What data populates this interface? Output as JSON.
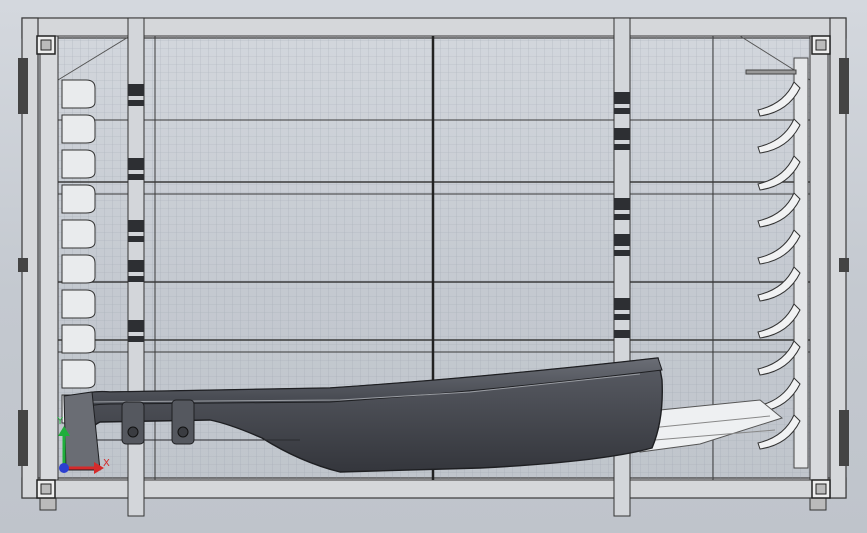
{
  "viewport": {
    "label": "graphics-area"
  },
  "colors": {
    "background": "#c9ced6",
    "frame_fill": "#d7d9dc",
    "frame_stroke": "#3a3a3a",
    "mesh_line": "#7d8590",
    "part_dark": "#4a4d55",
    "part_light": "#e8eaec",
    "axis_x": "#d42a2a",
    "axis_y": "#1fae3b",
    "axis_z": "#2b3fd1"
  },
  "triad": {
    "x_label": "X",
    "y_label": "Y"
  },
  "icons": {
    "corner": "corner-bracket-icon",
    "slot": "holder-slot-icon",
    "cradle": "cradle-hook-icon"
  }
}
